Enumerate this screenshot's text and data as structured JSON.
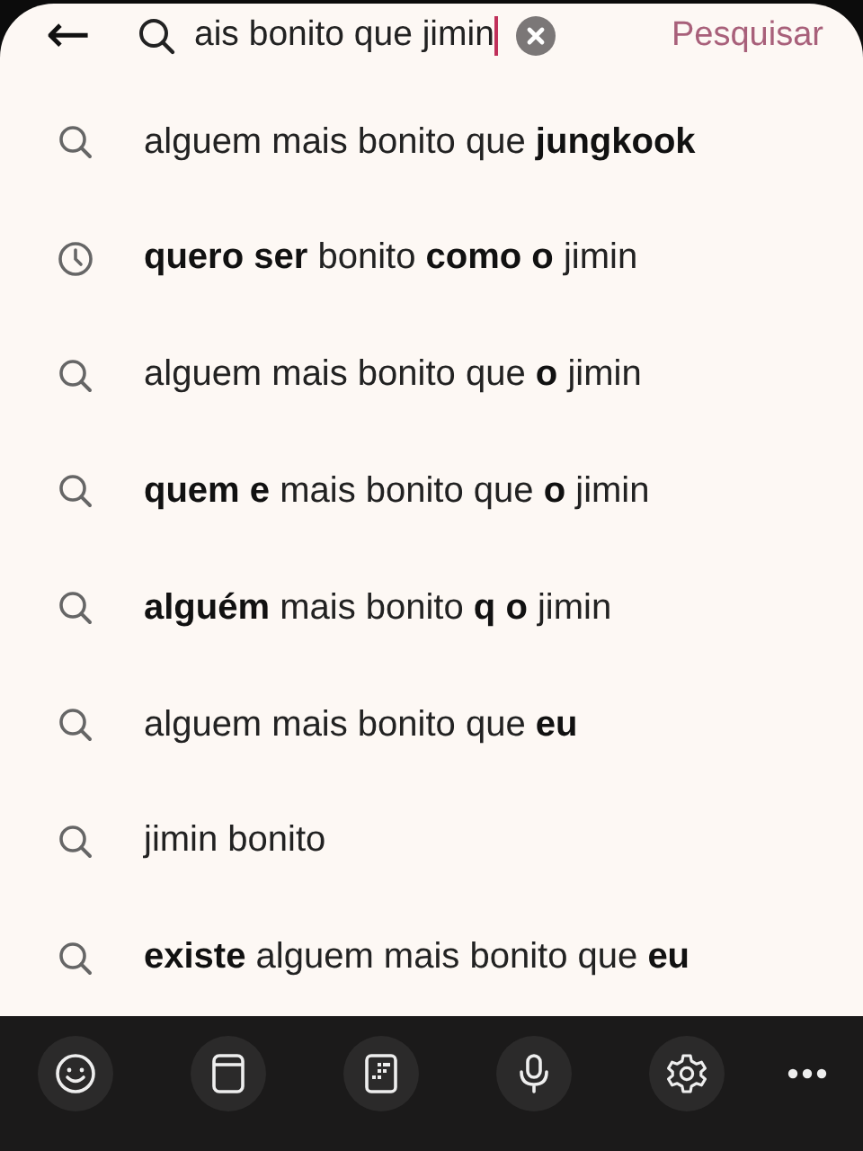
{
  "search_bar": {
    "back": "←",
    "query": "ais bonito que jimin",
    "submit": "Pesquisar"
  },
  "suggestions": [
    {
      "kind": "search",
      "text": "alguem mais bonito que **jungkook**"
    },
    {
      "kind": "history",
      "text": "**quero ser** bonito **como o** jimin"
    },
    {
      "kind": "search",
      "text": "alguem mais bonito que **o** jimin"
    },
    {
      "kind": "search",
      "text": "**quem e** mais bonito que **o** jimin"
    },
    {
      "kind": "search",
      "text": "**alguém** mais bonito **q o** jimin"
    },
    {
      "kind": "search",
      "text": "alguem mais bonito que **eu**"
    },
    {
      "kind": "search",
      "text": "jimin bonito"
    },
    {
      "kind": "search",
      "text": "**existe** alguem mais bonito que **eu**"
    }
  ],
  "keyboard_toolbar": [
    {
      "kind": "emoji"
    },
    {
      "kind": "clipboard"
    },
    {
      "kind": "keypad"
    },
    {
      "kind": "mic"
    },
    {
      "kind": "settings"
    },
    {
      "kind": "more"
    }
  ]
}
